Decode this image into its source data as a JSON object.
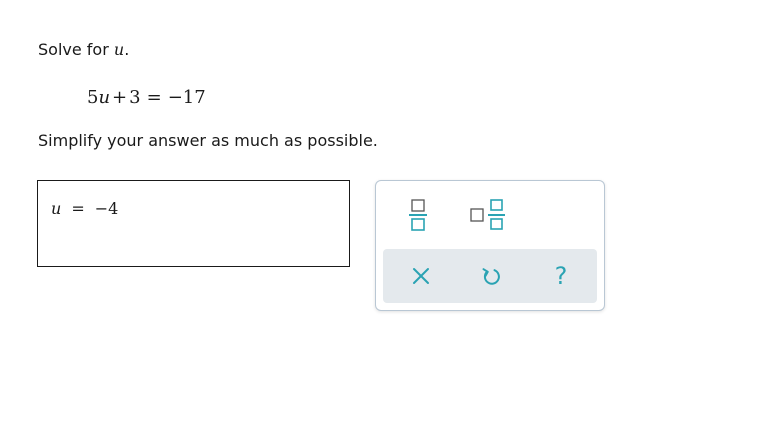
{
  "problem": {
    "prompt_prefix": "Solve for ",
    "variable": "u",
    "prompt_suffix": ".",
    "equation": {
      "coefficient": "5",
      "variable": "u",
      "plus": "+",
      "constant": "3",
      "equals": "=",
      "rhs": "−17"
    },
    "instruction": "Simplify your answer as much as possible."
  },
  "answer": {
    "variable": "u",
    "equals": "=",
    "value": "−4"
  },
  "keypad": {
    "accent_color": "#2aa3b3",
    "keys": [
      "fraction-icon",
      "mixed-number-icon"
    ],
    "actions": {
      "clear_icon": "x-icon",
      "undo_icon": "undo-icon",
      "help_label": "?"
    }
  }
}
